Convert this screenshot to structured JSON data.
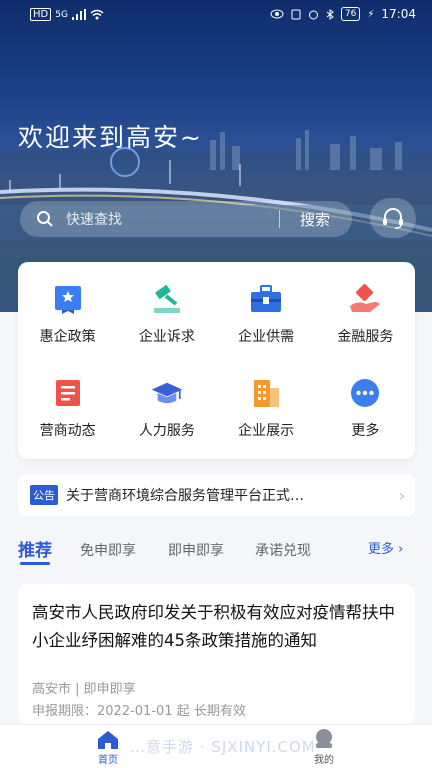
{
  "status_bar": {
    "network": "HD",
    "signal": "5G",
    "battery": "76",
    "time": "17:04"
  },
  "hero": {
    "welcome": "欢迎来到高安~"
  },
  "search": {
    "placeholder": "快速查找",
    "button": "搜索"
  },
  "services": [
    {
      "label": "惠企政策",
      "icon": "policy-icon",
      "color": "#3b7ef0"
    },
    {
      "label": "企业诉求",
      "icon": "gavel-icon",
      "color": "#22b59a"
    },
    {
      "label": "企业供需",
      "icon": "toolbox-icon",
      "color": "#2f6fe0"
    },
    {
      "label": "金融服务",
      "icon": "finance-hand-icon",
      "color": "#f0524b"
    },
    {
      "label": "营商动态",
      "icon": "news-icon",
      "color": "#f0524b"
    },
    {
      "label": "人力服务",
      "icon": "graduation-cap-icon",
      "color": "#3b5fd6"
    },
    {
      "label": "企业展示",
      "icon": "building-icon",
      "color": "#f39a2a"
    },
    {
      "label": "更多",
      "icon": "more-dots-icon",
      "color": "#3b7ef0"
    }
  ],
  "notice": {
    "tag": "公告",
    "text": "关于营商环境综合服务管理平台正式…"
  },
  "tabs": {
    "items": [
      "推荐",
      "免申即享",
      "即申即享",
      "承诺兑现"
    ],
    "active": "推荐",
    "more": "更多"
  },
  "article": {
    "title": "高安市人民政府印发关于积极有效应对疫情帮扶中小企业纾困解难的45条政策措施的通知",
    "meta": "高安市 | 即申即享",
    "period": "申报期限：2022-01-01 起 长期有效"
  },
  "bottom_nav": {
    "home": "首页",
    "mine": "我的"
  },
  "watermark": "…意手游 · SJXINYI.COM"
}
